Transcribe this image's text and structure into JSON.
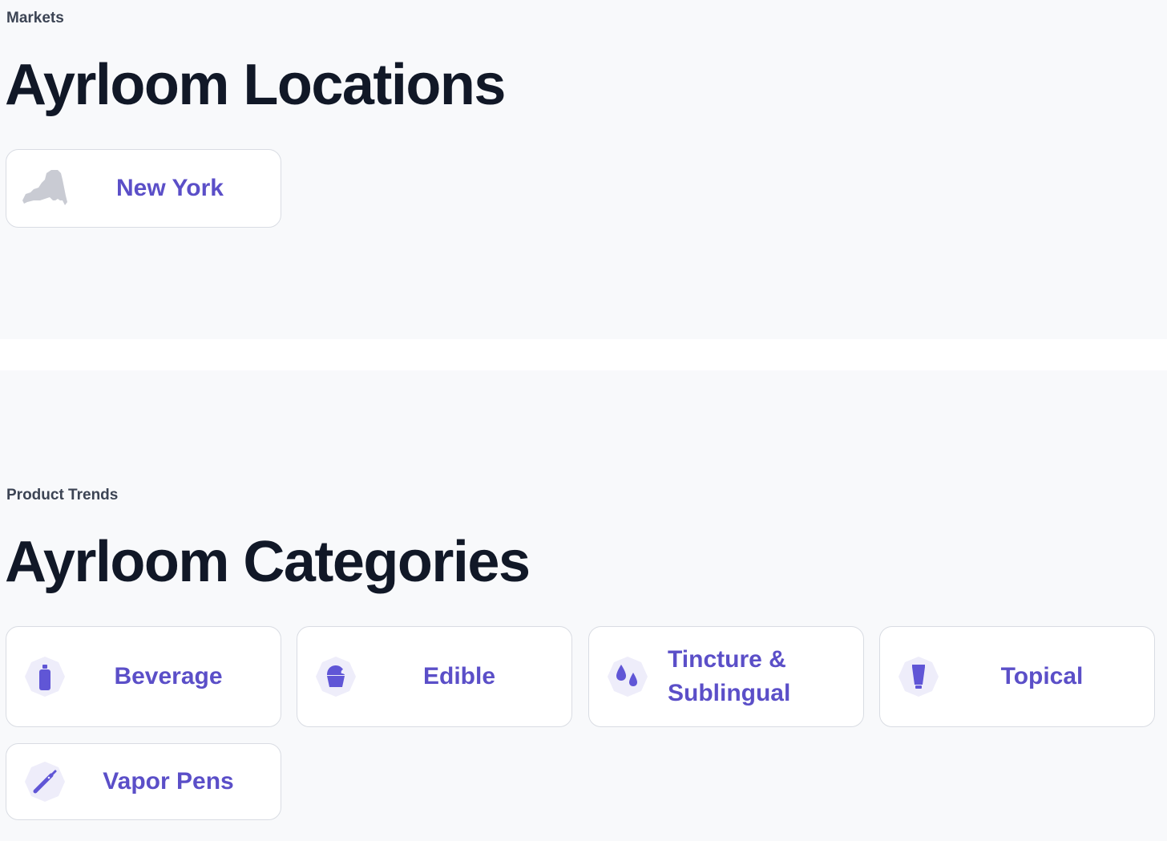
{
  "markets": {
    "eyebrow": "Markets",
    "heading": "Ayrloom Locations",
    "items": [
      {
        "label": "New York",
        "icon": "new-york-state-icon"
      }
    ]
  },
  "categories": {
    "eyebrow": "Product Trends",
    "heading": "Ayrloom Categories",
    "items": [
      {
        "label": "Beverage",
        "icon": "beverage-bottle-icon"
      },
      {
        "label": "Edible",
        "icon": "edible-cupcake-icon"
      },
      {
        "label": "Tincture & Sublingual",
        "icon": "tincture-drops-icon"
      },
      {
        "label": "Topical",
        "icon": "topical-tube-icon"
      },
      {
        "label": "Vapor Pens",
        "icon": "vapor-pen-icon"
      }
    ]
  },
  "colors": {
    "accent": "#5b4fc8",
    "icon_fill": "#6056d6",
    "icon_bg": "#eeedfa",
    "state_fill": "#c9cbd3",
    "heading": "#111827",
    "eyebrow": "#3c4454",
    "section_bg": "#f8f9fb",
    "card_border": "#d9dce3"
  }
}
